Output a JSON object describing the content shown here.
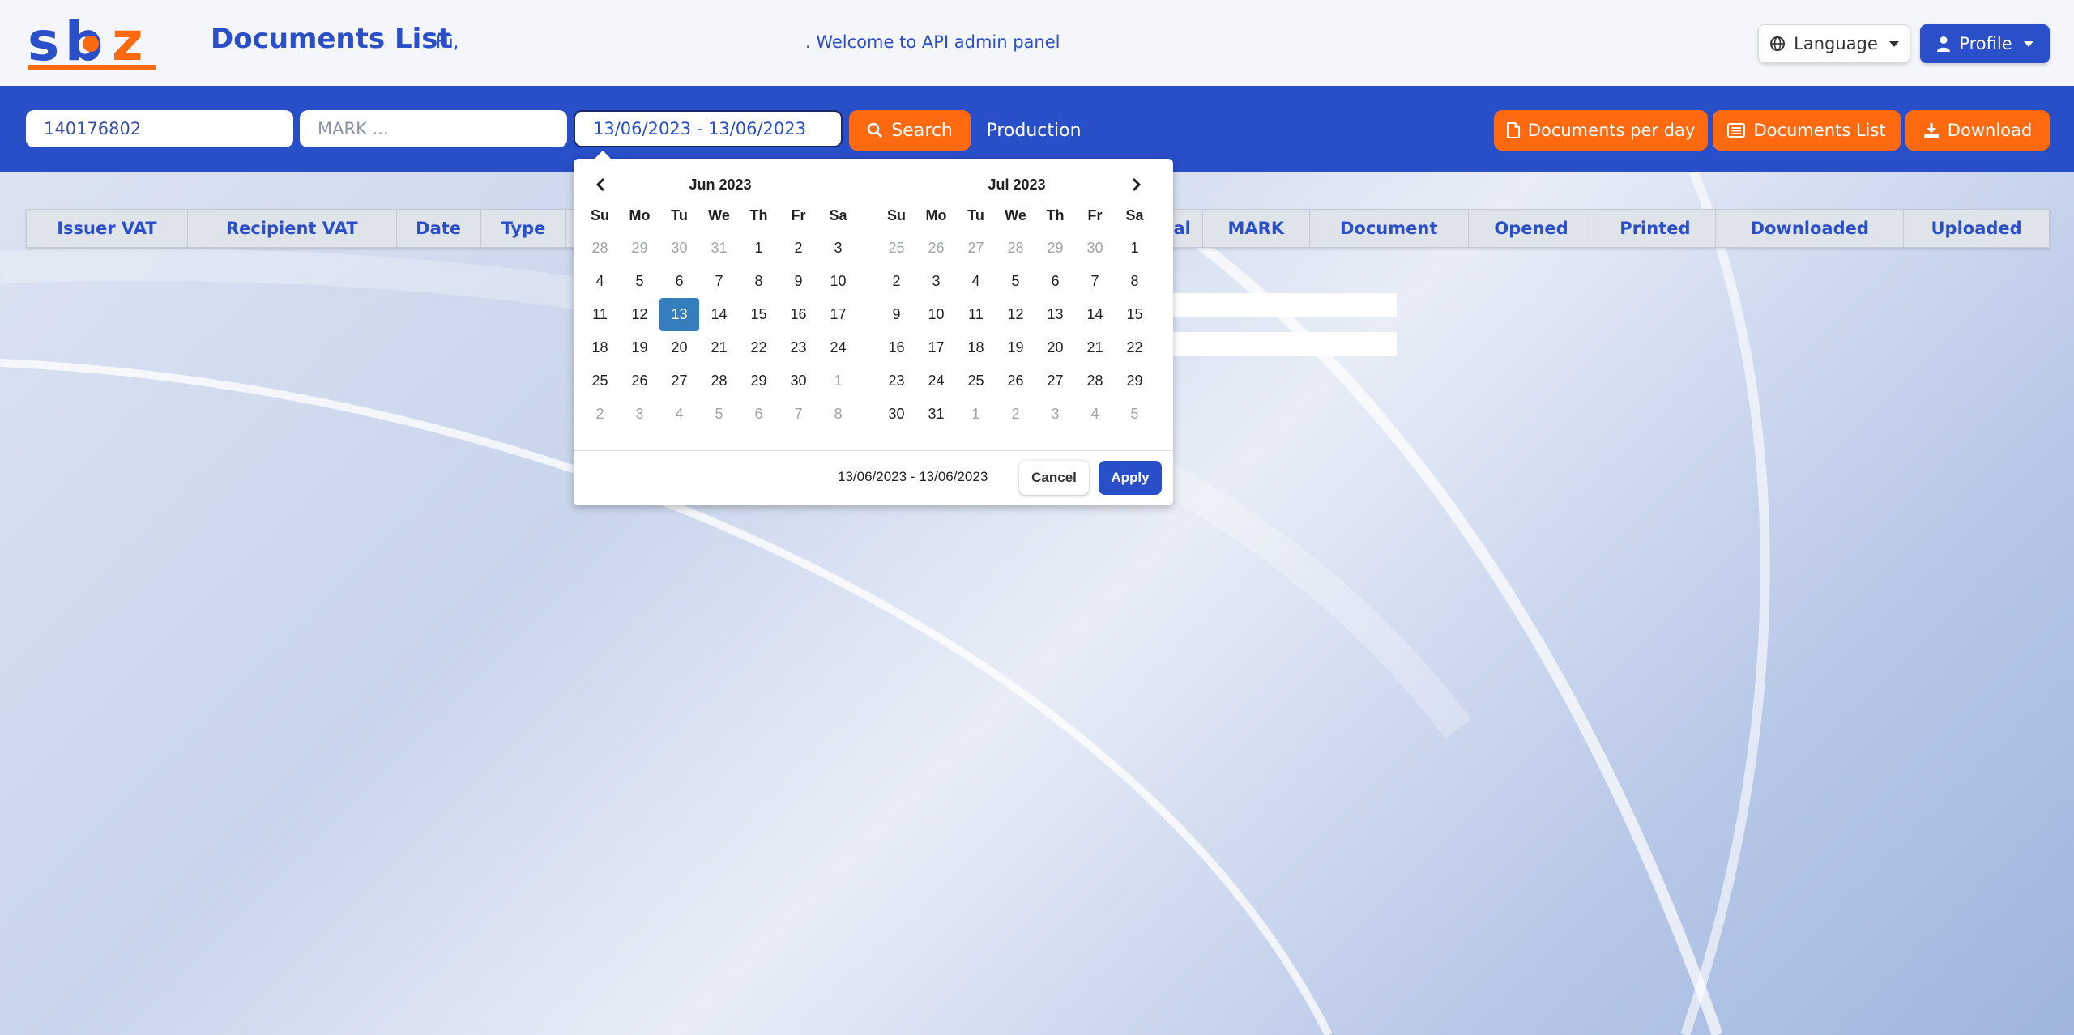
{
  "header": {
    "title": "Documents List",
    "greeting": "Hi,",
    "welcome": ". Welcome to API admin panel",
    "language_label": "Language",
    "profile_label": "Profile"
  },
  "filters": {
    "vat_value": "140176802",
    "mark_placeholder": "MARK ...",
    "date_range_value": "13/06/2023 - 13/06/2023",
    "search_label": "Search",
    "environment_label": "Production",
    "docs_per_day_label": "Documents per day",
    "docs_list_label": "Documents List",
    "download_label": "Download"
  },
  "table": {
    "columns": [
      "Issuer VAT",
      "Recipient VAT",
      "Date",
      "Type",
      "tal",
      "MARK",
      "Document",
      "Opened",
      "Printed",
      "Downloaded",
      "Uploaded"
    ]
  },
  "datepicker": {
    "weekdays": [
      "Su",
      "Mo",
      "Tu",
      "We",
      "Th",
      "Fr",
      "Sa"
    ],
    "left": {
      "month_label": "Jun 2023",
      "weeks": [
        [
          [
            "28",
            1
          ],
          [
            "29",
            1
          ],
          [
            "30",
            1
          ],
          [
            "31",
            1
          ],
          [
            "1",
            0
          ],
          [
            "2",
            0
          ],
          [
            "3",
            0
          ]
        ],
        [
          [
            "4",
            0
          ],
          [
            "5",
            0
          ],
          [
            "6",
            0
          ],
          [
            "7",
            0
          ],
          [
            "8",
            0
          ],
          [
            "9",
            0
          ],
          [
            "10",
            0
          ]
        ],
        [
          [
            "11",
            0
          ],
          [
            "12",
            0
          ],
          [
            "13",
            2
          ],
          [
            "14",
            0
          ],
          [
            "15",
            0
          ],
          [
            "16",
            0
          ],
          [
            "17",
            0
          ]
        ],
        [
          [
            "18",
            0
          ],
          [
            "19",
            0
          ],
          [
            "20",
            0
          ],
          [
            "21",
            0
          ],
          [
            "22",
            0
          ],
          [
            "23",
            0
          ],
          [
            "24",
            0
          ]
        ],
        [
          [
            "25",
            0
          ],
          [
            "26",
            0
          ],
          [
            "27",
            0
          ],
          [
            "28",
            0
          ],
          [
            "29",
            0
          ],
          [
            "30",
            0
          ],
          [
            "1",
            1
          ]
        ],
        [
          [
            "2",
            1
          ],
          [
            "3",
            1
          ],
          [
            "4",
            1
          ],
          [
            "5",
            1
          ],
          [
            "6",
            1
          ],
          [
            "7",
            1
          ],
          [
            "8",
            1
          ]
        ]
      ]
    },
    "right": {
      "month_label": "Jul 2023",
      "weeks": [
        [
          [
            "25",
            1
          ],
          [
            "26",
            1
          ],
          [
            "27",
            1
          ],
          [
            "28",
            1
          ],
          [
            "29",
            1
          ],
          [
            "30",
            1
          ],
          [
            "1",
            0
          ]
        ],
        [
          [
            "2",
            0
          ],
          [
            "3",
            0
          ],
          [
            "4",
            0
          ],
          [
            "5",
            0
          ],
          [
            "6",
            0
          ],
          [
            "7",
            0
          ],
          [
            "8",
            0
          ]
        ],
        [
          [
            "9",
            0
          ],
          [
            "10",
            0
          ],
          [
            "11",
            0
          ],
          [
            "12",
            0
          ],
          [
            "13",
            0
          ],
          [
            "14",
            0
          ],
          [
            "15",
            0
          ]
        ],
        [
          [
            "16",
            0
          ],
          [
            "17",
            0
          ],
          [
            "18",
            0
          ],
          [
            "19",
            0
          ],
          [
            "20",
            0
          ],
          [
            "21",
            0
          ],
          [
            "22",
            0
          ]
        ],
        [
          [
            "23",
            0
          ],
          [
            "24",
            0
          ],
          [
            "25",
            0
          ],
          [
            "26",
            0
          ],
          [
            "27",
            0
          ],
          [
            "28",
            0
          ],
          [
            "29",
            0
          ]
        ],
        [
          [
            "30",
            0
          ],
          [
            "31",
            0
          ],
          [
            "1",
            1
          ],
          [
            "2",
            1
          ],
          [
            "3",
            1
          ],
          [
            "4",
            1
          ],
          [
            "5",
            1
          ]
        ]
      ]
    },
    "selected_range": "13/06/2023 - 13/06/2023",
    "cancel_label": "Cancel",
    "apply_label": "Apply"
  },
  "colors": {
    "brand_blue": "#284ec8",
    "accent_orange": "#ff6a10",
    "selected_day": "#357ebd"
  }
}
